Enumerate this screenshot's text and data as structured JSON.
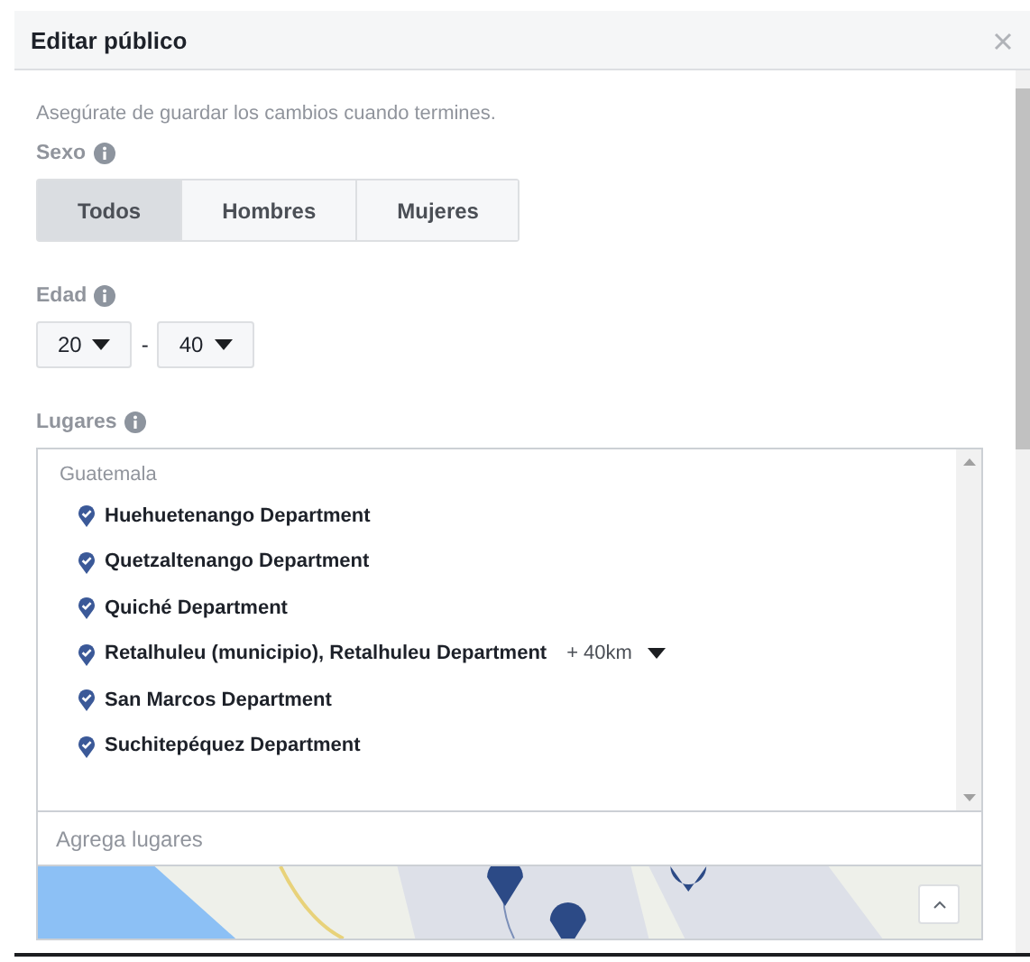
{
  "window": {
    "title": "Editar público"
  },
  "notice": "Asegúrate de guardar los cambios cuando termines.",
  "sexo": {
    "label": "Sexo",
    "options": [
      {
        "label": "Todos",
        "selected": true
      },
      {
        "label": "Hombres",
        "selected": false
      },
      {
        "label": "Mujeres",
        "selected": false
      }
    ]
  },
  "edad": {
    "label": "Edad",
    "min": "20",
    "separator": "-",
    "max": "40"
  },
  "lugares": {
    "label": "Lugares",
    "group": "Guatemala",
    "items": [
      {
        "name": "Huehuetenango Department"
      },
      {
        "name": "Quetzaltenango Department"
      },
      {
        "name": "Quiché Department"
      },
      {
        "name": "Retalhuleu (municipio), Retalhuleu Department",
        "radius": "+ 40km"
      },
      {
        "name": "San Marcos Department"
      },
      {
        "name": "Suchitepéquez Department"
      }
    ],
    "placeholder": "Agrega lugares"
  }
}
